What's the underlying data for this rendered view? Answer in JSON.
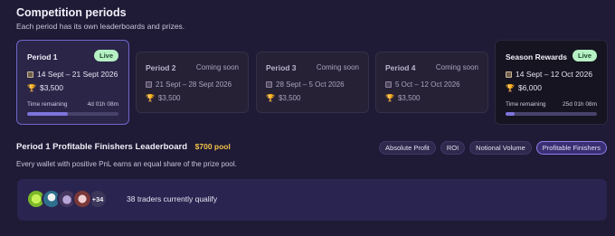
{
  "section": {
    "title": "Competition periods",
    "subtitle": "Each period has its own leaderboards and prizes."
  },
  "periods": [
    {
      "name": "Period 1",
      "status": "Live",
      "dates": "14 Sept – 21 Sept 2026",
      "prize": "$3,500",
      "time_label": "Time remaining",
      "time_value": "4d 01h 08m",
      "progress": 0.45
    },
    {
      "name": "Period 2",
      "status": "Coming soon",
      "dates": "21 Sept – 28 Sept 2026",
      "prize": "$3,500"
    },
    {
      "name": "Period 3",
      "status": "Coming soon",
      "dates": "28 Sept – 5 Oct 2026",
      "prize": "$3,500"
    },
    {
      "name": "Period 4",
      "status": "Coming soon",
      "dates": "5 Oct – 12 Oct 2026",
      "prize": "$3,500"
    }
  ],
  "season": {
    "name": "Season Rewards",
    "status": "Live",
    "dates": "14 Sept – 12 Oct 2026",
    "prize": "$6,000",
    "time_label": "Time remaining",
    "time_value": "25d 01h 08m",
    "progress": 0.1
  },
  "leaderboard": {
    "title": "Period 1 Profitable Finishers Leaderboard",
    "pool": "$700 pool",
    "description": "Every wallet with positive PnL earns an equal share of the prize pool.",
    "tabs": [
      "Absolute Profit",
      "ROI",
      "Notional Volume",
      "Profitable Finishers"
    ],
    "selected_tab": "Profitable Finishers"
  },
  "qualify": {
    "more_count": "+34",
    "text": "38 traders currently qualify"
  },
  "icons": {
    "calendar": "calendar-icon",
    "trophy": "trophy-icon"
  },
  "colors": {
    "accent": "#7d74dc",
    "live_badge": "#b6f0c4",
    "pool": "#f3c24a"
  }
}
